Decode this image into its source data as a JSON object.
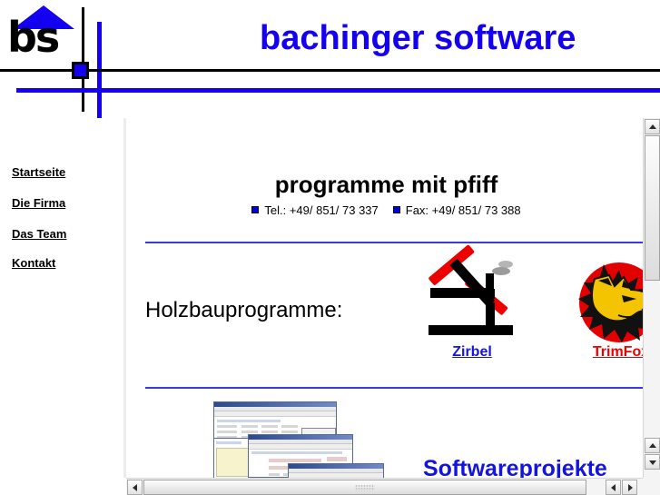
{
  "header": {
    "logo_text": "bs",
    "logo_icon": "house-roof-icon",
    "brand_title": "bachinger software"
  },
  "sidebar": {
    "items": [
      {
        "label": "Startseite"
      },
      {
        "label": "Die Firma"
      },
      {
        "label": "Das Team"
      },
      {
        "label": "Kontakt"
      }
    ]
  },
  "content": {
    "page_heading": "programme mit pfiff",
    "contact": {
      "tel": "Tel.: +49/ 851/ 73 337",
      "fax": "Fax: +49/ 851/ 73 388"
    },
    "section_label": "Holzbauprogramme:",
    "products": [
      {
        "name": "Zirbel",
        "icon": "zirbel-house-logo-icon"
      },
      {
        "name": "TrimFox",
        "icon": "trimfox-fox-logo-icon"
      }
    ],
    "projects_heading": "Softwareprojekte",
    "screenshot_alt": "cascading-application-windows-thumbnail"
  },
  "colors": {
    "brand_blue": "#1400f0",
    "link_blue": "#1414e0",
    "link_red": "#ef0000",
    "rule_blue": "#3a3ad8",
    "fox_red": "#e20000",
    "fox_gold": "#f5c400",
    "roof_red": "#ee0000"
  },
  "scrollbars": {
    "vertical": {
      "up": "scroll-up-arrow",
      "down": "scroll-down-arrow"
    },
    "horizontal": {
      "left": "scroll-left-arrow",
      "right": "scroll-right-arrow"
    }
  }
}
